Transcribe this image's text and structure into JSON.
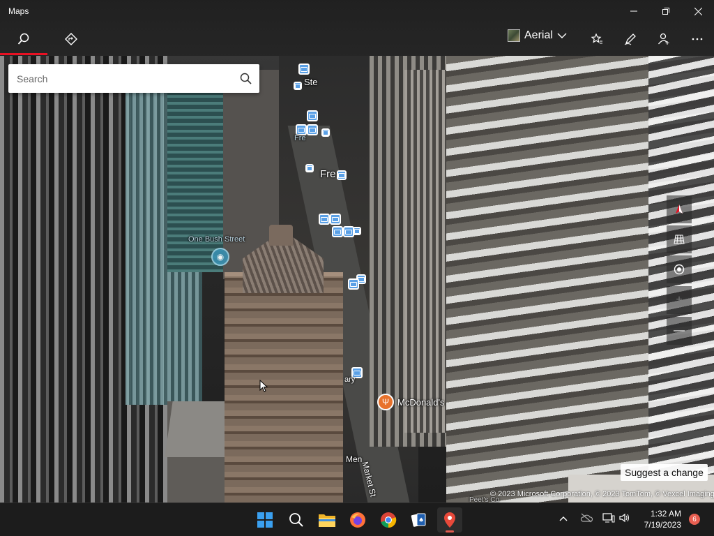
{
  "window": {
    "title": "Maps",
    "minimize_icon": "minimize-icon",
    "maximize_icon": "restore-icon",
    "close_icon": "close-icon"
  },
  "toolbar": {
    "search_tab_icon": "search-icon",
    "directions_tab_icon": "directions-icon",
    "map_style_label": "Aerial",
    "favorites_icon": "favorites-icon",
    "ink_icon": "ink-pen-icon",
    "account_icon": "add-person-icon",
    "more_icon": "more-icon",
    "accent_color": "#e81123"
  },
  "search": {
    "placeholder": "Search",
    "value": ""
  },
  "map": {
    "labels": {
      "ste": "Ste",
      "fre": "Fre",
      "one_bush_street": "One Bush Street",
      "mcdonalds": "McDonald's",
      "market_st": "Market St",
      "men": "Men",
      "fre_small": "Fre",
      "gary": "ary",
      "peets": "Peet's Co"
    },
    "transit_marker_color": "#5aa0e6",
    "restaurant_marker_color": "#e8722c"
  },
  "controls": {
    "compass_icon": "compass-icon",
    "tilt_icon": "3d-grid-icon",
    "locate_icon": "my-location-icon",
    "zoom_in_label": "+",
    "zoom_out_label": "—"
  },
  "suggest_change": "Suggest a change",
  "copyright": "© 2023 Microsoft Corporation, © 2023 TomTom, © Vexcel Imaging",
  "taskbar": {
    "apps": [
      "start-icon",
      "search-icon",
      "file-explorer-icon",
      "firefox-icon",
      "chrome-icon",
      "solitaire-icon",
      "maps-icon"
    ],
    "clock_time": "1:32 AM",
    "clock_date": "7/19/2023",
    "notification_count": "6"
  }
}
